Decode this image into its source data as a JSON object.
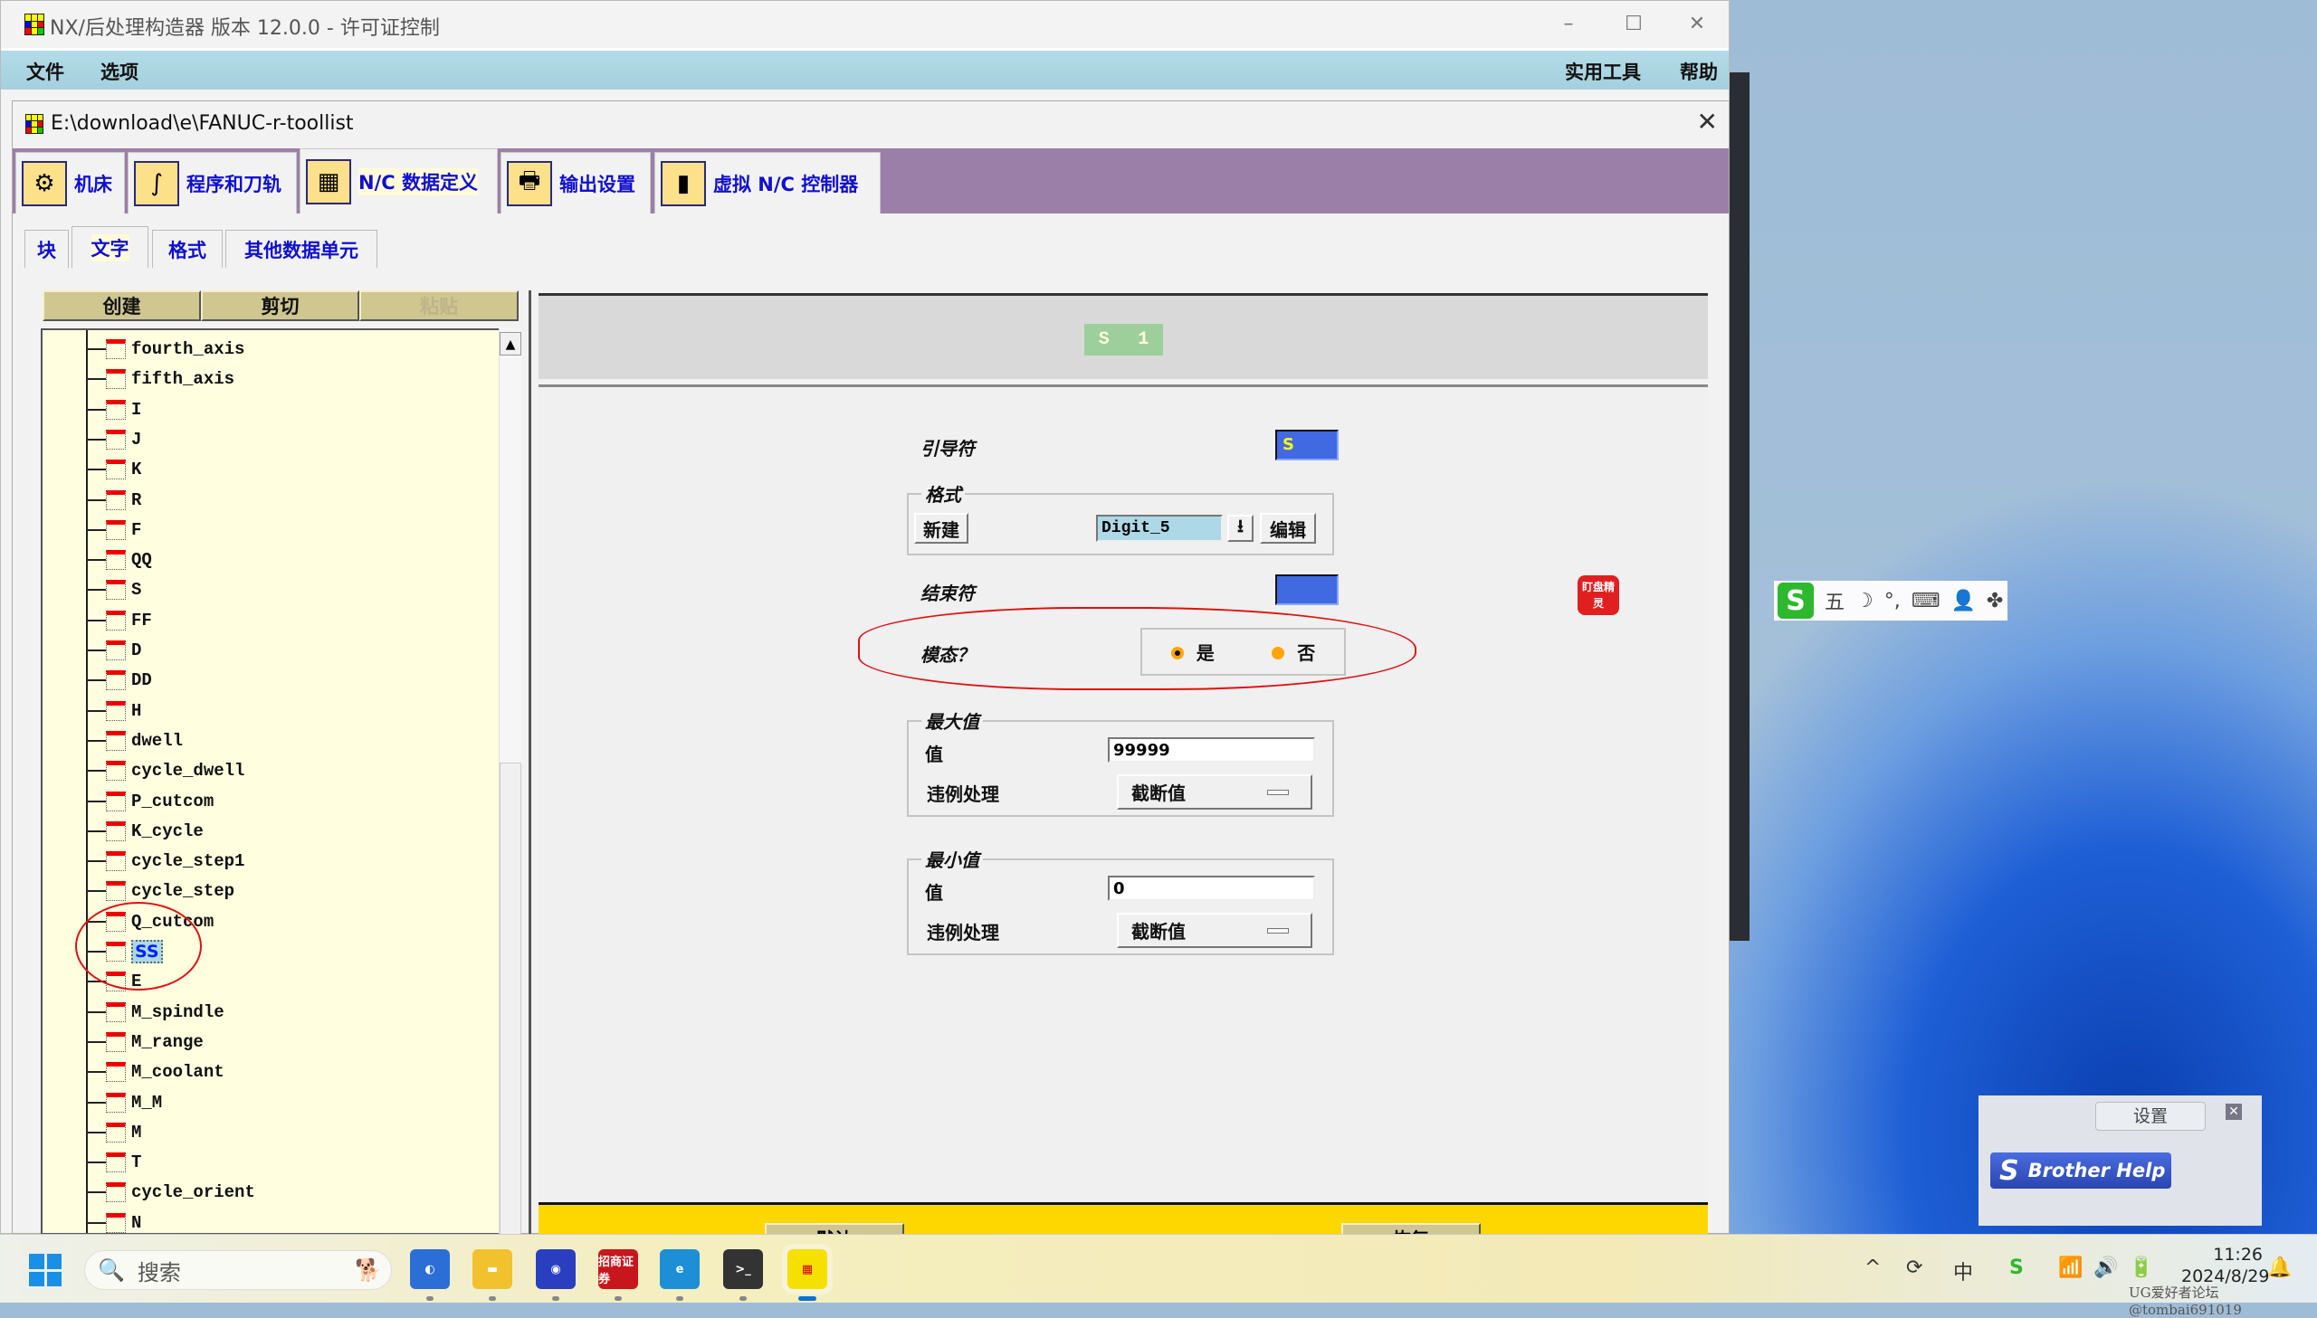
{
  "app": {
    "title": "NX/后处理构造器 版本 12.0.0 - 许可证控制",
    "window_controls": {
      "minimize": "–",
      "maximize": "☐",
      "close": "✕"
    },
    "menu_left": [
      "文件",
      "选项"
    ],
    "menu_right": [
      "实用工具",
      "帮助"
    ]
  },
  "doc": {
    "title": "E:\\download\\e\\FANUC-r-toollist",
    "close": "✕",
    "main_tabs": [
      {
        "label": "机床",
        "icon": "machine-tool-icon",
        "glyph": "⚙"
      },
      {
        "label": "程序和刀轨",
        "icon": "program-toolpath-icon",
        "glyph": "∫"
      },
      {
        "label": "N/C 数据定义",
        "icon": "nc-data-icon",
        "glyph": "▦",
        "active": true
      },
      {
        "label": "输出设置",
        "icon": "printer-icon",
        "glyph": "🖶"
      },
      {
        "label": "虚拟 N/C 控制器",
        "icon": "virtual-controller-icon",
        "glyph": "▮"
      }
    ],
    "sub_tabs": [
      {
        "label": "块"
      },
      {
        "label": "文字",
        "active": true
      },
      {
        "label": "格式"
      },
      {
        "label": "其他数据单元"
      }
    ]
  },
  "tree_panel": {
    "buttons": {
      "create": "创建",
      "cut": "剪切",
      "paste": "粘贴"
    },
    "items": [
      "fourth_axis",
      "fifth_axis",
      "I",
      "J",
      "K",
      "R",
      "F",
      "QQ",
      "S",
      "FF",
      "D",
      "DD",
      "H",
      "dwell",
      "cycle_dwell",
      "P_cutcom",
      "K_cycle",
      "cycle_step1",
      "cycle_step",
      "Q_cutcom",
      "SS",
      "E",
      "M_spindle",
      "M_range",
      "M_coolant",
      "M_M",
      "M",
      "T",
      "cycle_orient",
      "N"
    ],
    "selected": "SS"
  },
  "word_editor": {
    "preview": {
      "leader": "S",
      "value": "1"
    },
    "leader_label": "引导符",
    "leader_value": "S",
    "format_group": "格式",
    "new_button": "新建",
    "format_value": "Digit_5",
    "format_dropdown_arrow": "⭳",
    "edit_button": "编辑",
    "trailer_label": "结束符",
    "trailer_value": "",
    "modal_label": "模态？",
    "modal_yes": "是",
    "modal_no": "否",
    "modal_selected": "是",
    "max_group": "最大值",
    "max_value_label": "值",
    "max_value": "99999",
    "max_violation_label": "违例处理",
    "max_violation": "截断值",
    "min_group": "最小值",
    "min_value_label": "值",
    "min_value": "0",
    "min_violation_label": "违例处理",
    "min_violation": "截断值",
    "default_button": "默认",
    "restore_button": "恢复"
  },
  "desktop": {
    "ime": {
      "logo": "S",
      "mode": "五",
      "items": [
        "☽",
        "°,",
        "⌨",
        "👤",
        "✤"
      ]
    },
    "dingpan_widget": "盯盘精灵",
    "brother": {
      "settings": "设置",
      "close": "✕",
      "help": "Brother Help"
    }
  },
  "taskbar": {
    "search_placeholder": "搜索",
    "apps": [
      {
        "name": "nx-app",
        "glyph": "◐",
        "color": "#2b6fd6"
      },
      {
        "name": "file-explorer",
        "glyph": "▬",
        "color": "#f2c12e"
      },
      {
        "name": "eye-app",
        "glyph": "◉",
        "color": "#2a3fbf"
      },
      {
        "name": "cms-securities",
        "glyph": "招商证券",
        "color": "#c8161d"
      },
      {
        "name": "edge-browser",
        "glyph": "e",
        "color": "#1c8fd6"
      },
      {
        "name": "terminal",
        "glyph": ">_",
        "color": "#333"
      },
      {
        "name": "post-builder",
        "glyph": "▦",
        "color": "#f5e000"
      }
    ],
    "tray": {
      "chevron": "^",
      "sync": "⟳",
      "ime": "中",
      "sogou": "S",
      "wifi": "📶",
      "volume": "🔊",
      "battery": "🔋",
      "bell": "🔔"
    },
    "time": "11:26",
    "date": "2024/8/29",
    "watermark": "UG爱好者论坛@tombai691019"
  },
  "colors": {
    "accent_blue": "#1010d0",
    "tab_strip": "#9b7fa8",
    "tree_bg": "#ffffe0",
    "footer": "#ffd700",
    "preview_badge": "#9ccf99",
    "field_blue": "#4169e1"
  }
}
